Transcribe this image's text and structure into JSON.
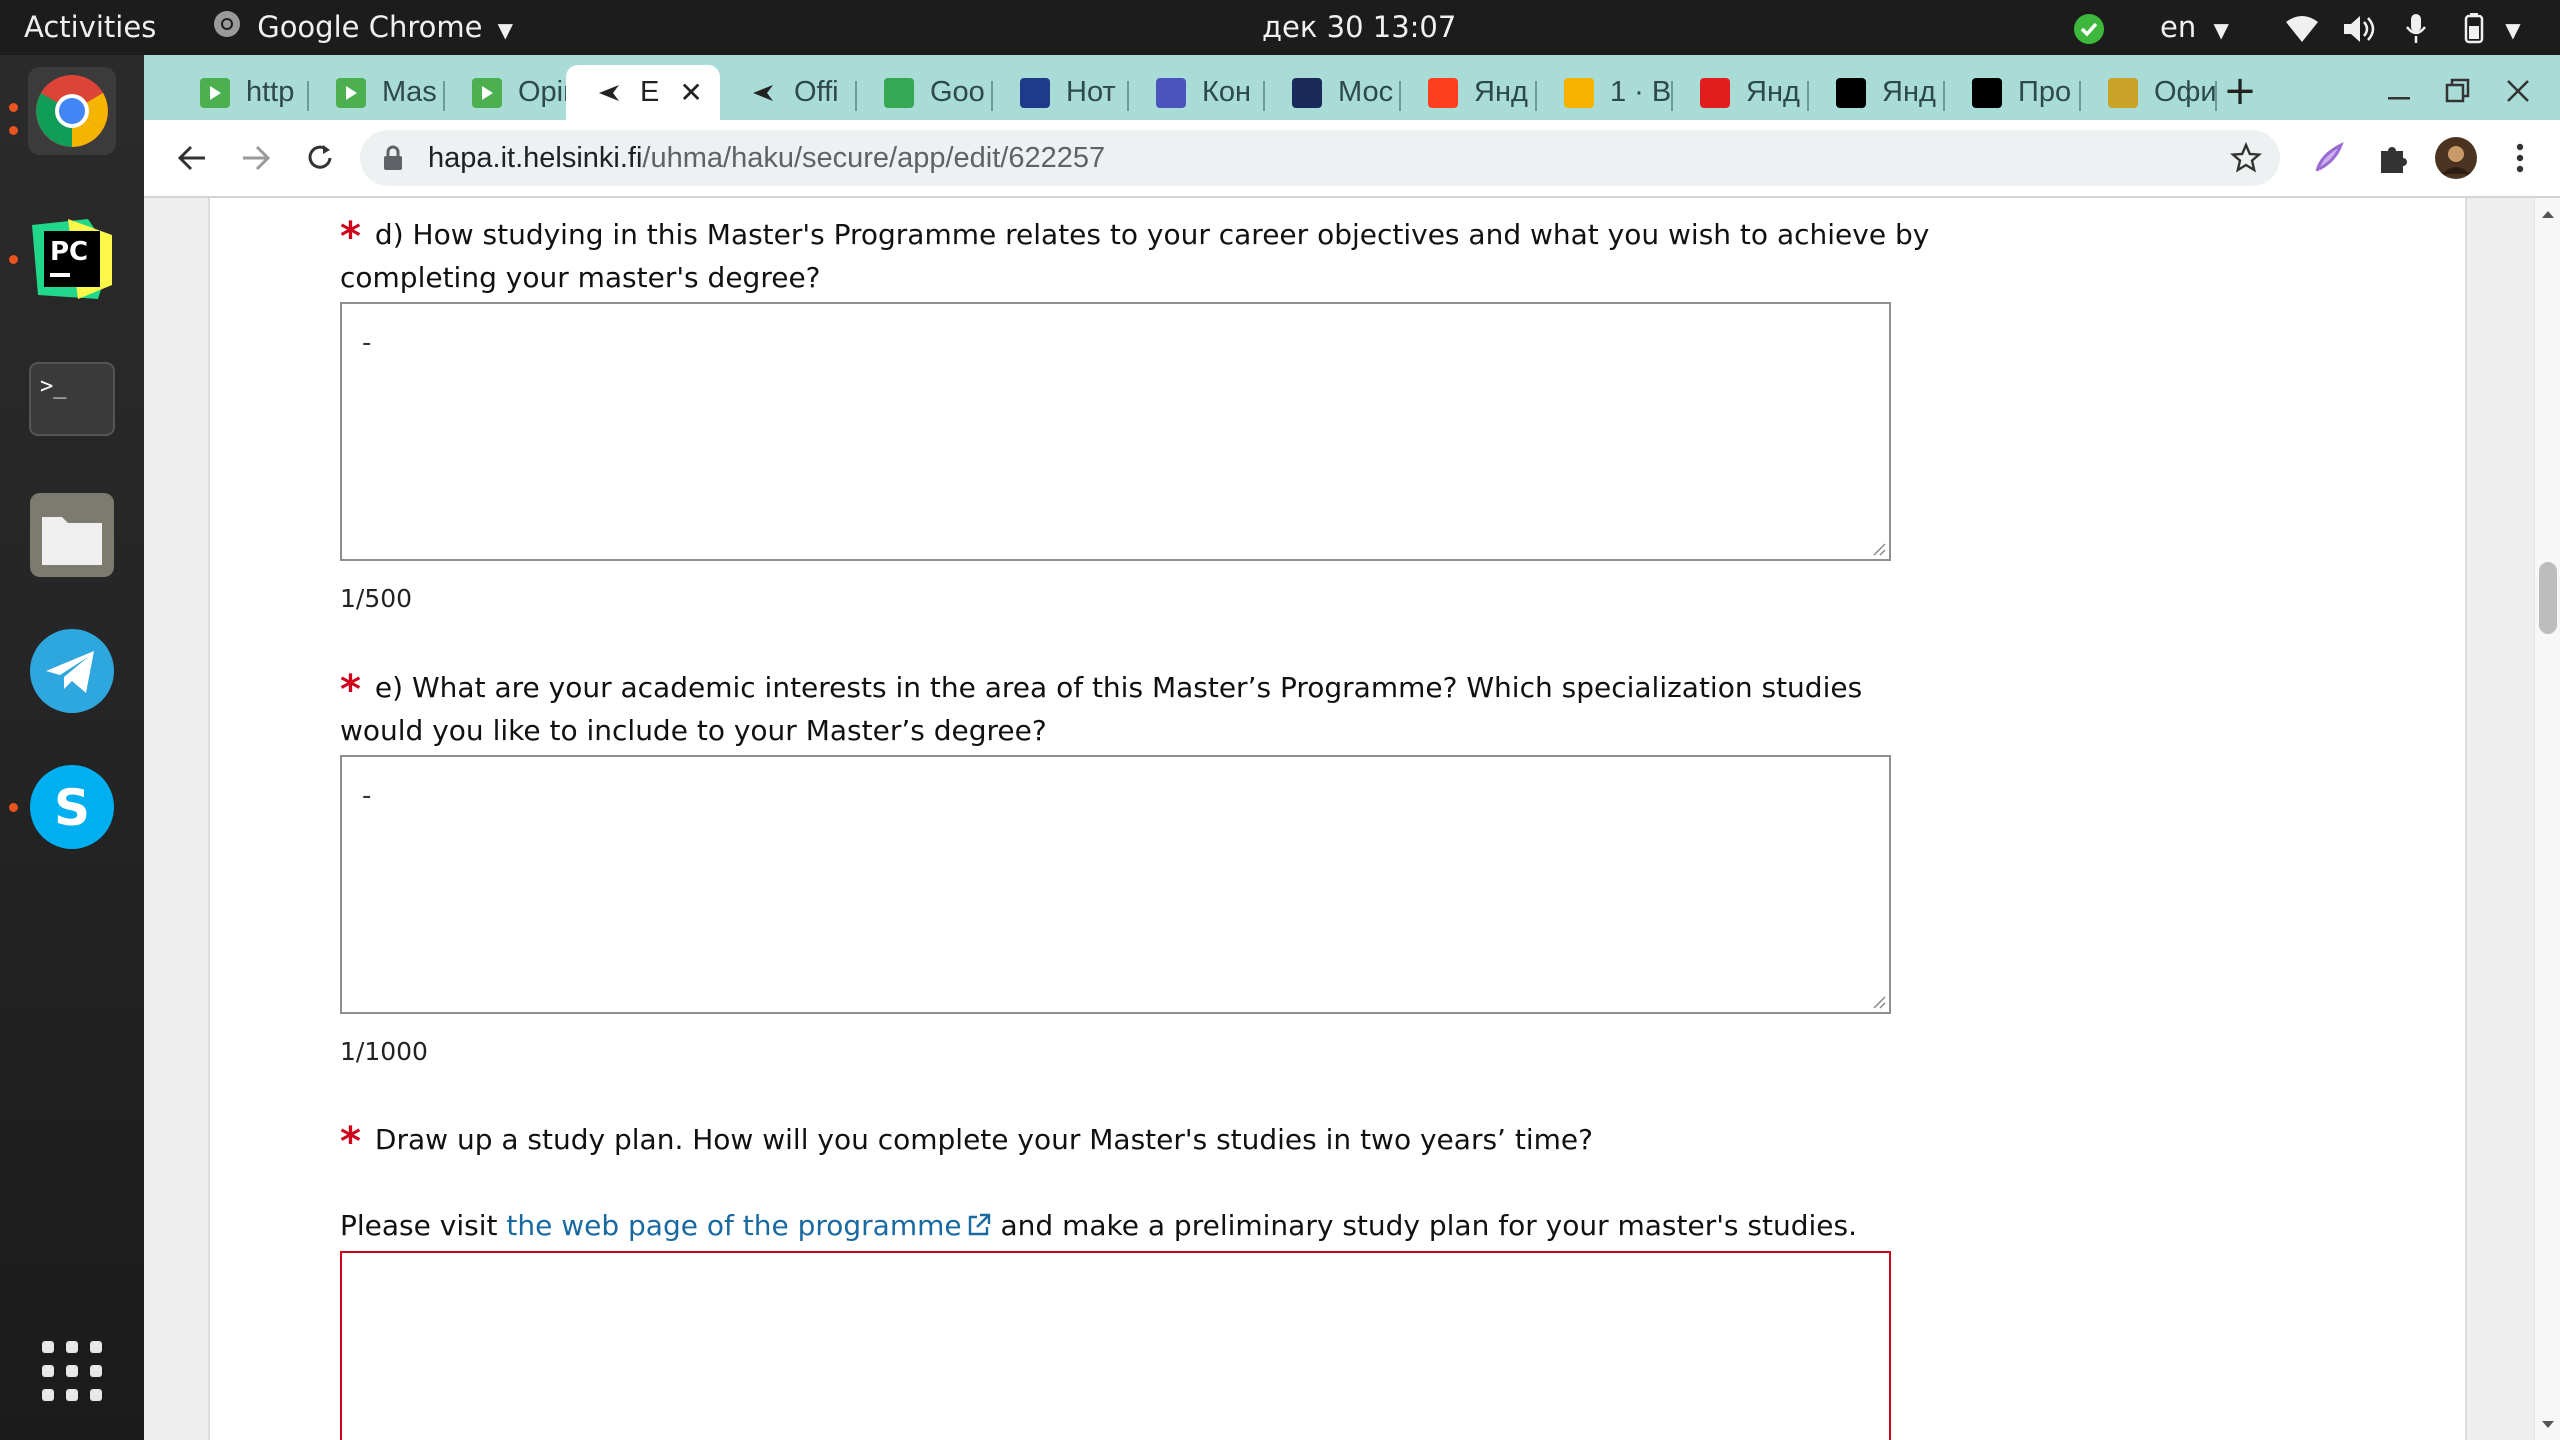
{
  "system_bar": {
    "activities": "Activities",
    "app_name": "Google Chrome",
    "datetime": "дек 30  13:07",
    "language": "en"
  },
  "dock": {
    "apps": [
      {
        "name": "Google Chrome",
        "icon": "chrome-icon"
      },
      {
        "name": "PyCharm",
        "icon": "pycharm-icon",
        "label": "PC"
      },
      {
        "name": "Terminal",
        "icon": "terminal-icon",
        "label": ">_"
      },
      {
        "name": "Files",
        "icon": "files-icon"
      },
      {
        "name": "Telegram",
        "icon": "telegram-icon"
      },
      {
        "name": "Skype",
        "icon": "skype-icon",
        "label": "S"
      }
    ],
    "show_apps_icon": "app-grid-icon"
  },
  "browser": {
    "tabs": [
      {
        "label": "http",
        "favicon": "green-play-favicon"
      },
      {
        "label": "Mas",
        "favicon": "green-play-favicon"
      },
      {
        "label": "Opir",
        "favicon": "green-play-favicon"
      },
      {
        "label": "E",
        "favicon": "helsinki-favicon",
        "active": true
      },
      {
        "label": "Offi",
        "favicon": "helsinki-favicon"
      },
      {
        "label": "Goo",
        "favicon": "maps-pin-favicon"
      },
      {
        "label": "Нот",
        "favicon": "blue-grid-favicon"
      },
      {
        "label": "Кон",
        "favicon": "teams-favicon"
      },
      {
        "label": "Мос",
        "favicon": "msu-favicon"
      },
      {
        "label": "Янд",
        "favicon": "yandex-favicon"
      },
      {
        "label": "1 · В",
        "favicon": "mail-favicon"
      },
      {
        "label": "Янд",
        "favicon": "yandex-red-favicon"
      },
      {
        "label": "Янд",
        "favicon": "black-square-favicon"
      },
      {
        "label": "Про",
        "favicon": "black-square-favicon"
      },
      {
        "label": "Офи",
        "favicon": "crest-favicon"
      }
    ],
    "url_host": "hapa.it.helsinki.fi",
    "url_path": "/uhma/haku/secure/app/edit/622257"
  },
  "form": {
    "question_d": {
      "text": "d) How studying in this Master's Programme relates to your career objectives and what you wish to achieve by completing your master's degree?",
      "value": "-",
      "counter": "1/500"
    },
    "question_e": {
      "text": "e) What are your academic interests in the area of this Master’s Programme? Which specialization studies would you like to include to your Master’s degree?",
      "value": "-",
      "counter": "1/1000"
    },
    "study_plan": {
      "text": "Draw up a study plan. How will you complete your Master's studies in two years’ time?",
      "instruction_before": "Please visit ",
      "link_text": "the web page of the programme",
      "instruction_after": " and make a preliminary study plan for your master's studies.",
      "value": ""
    },
    "required_marker": "*"
  },
  "colors": {
    "required": "#d0021b",
    "link": "#1a6aa2",
    "tabstrip": "#a9dcd7"
  }
}
